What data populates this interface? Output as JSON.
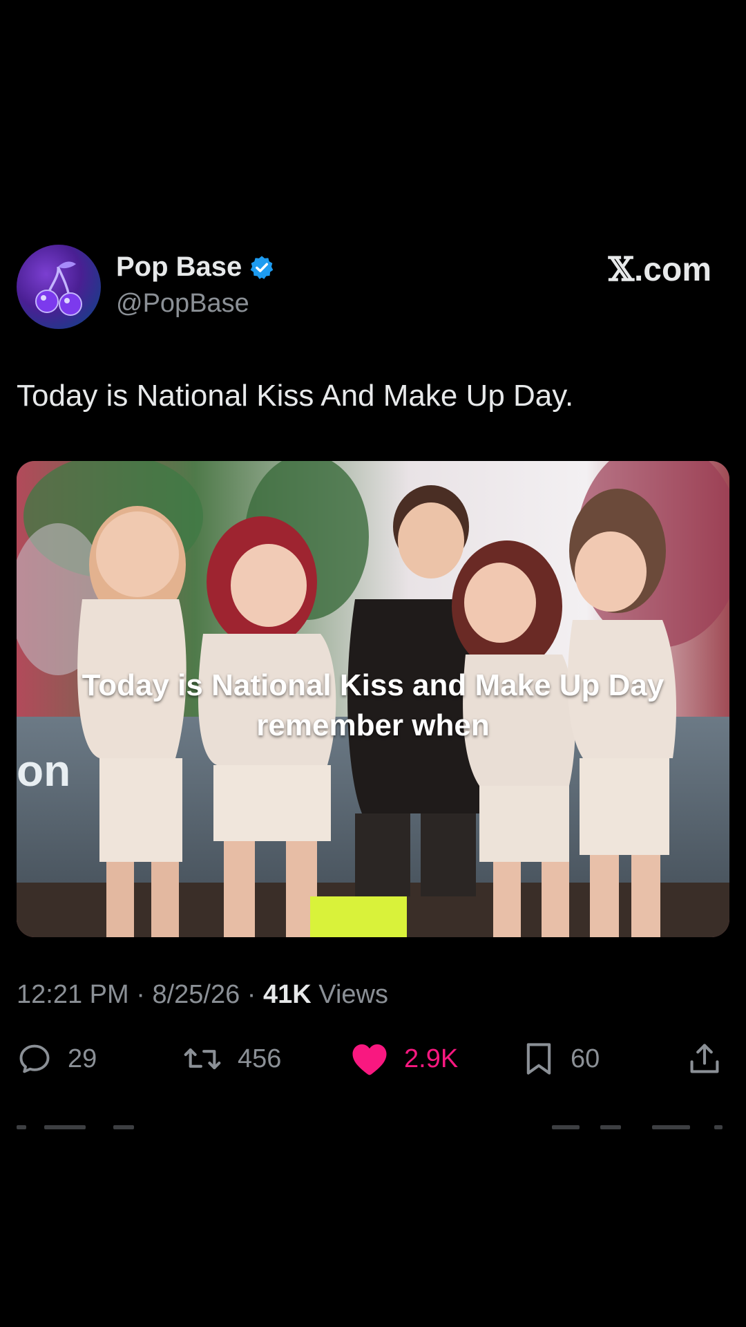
{
  "brand": {
    "x_mark": "𝕏",
    "suffix": ".com"
  },
  "author": {
    "name": "Pop Base",
    "handle": "@PopBase",
    "verified": true,
    "verified_color": "#1d9bf0",
    "avatar_icon": "cherries-icon"
  },
  "tweet": {
    "text": "Today is National Kiss And Make Up Day."
  },
  "media": {
    "caption_line1": "Today is National Kiss and Make Up Day",
    "caption_line2": "remember when",
    "background_sign_text": "on"
  },
  "meta": {
    "time": "12:21 PM",
    "sep1": " · ",
    "date": "8/25/26",
    "sep2": " · ",
    "views_count": "41K",
    "views_label": " Views"
  },
  "actions": {
    "replies": "29",
    "reposts": "456",
    "likes": "2.9K",
    "bookmarks": "60",
    "like_color": "#f91880",
    "liked": true
  }
}
